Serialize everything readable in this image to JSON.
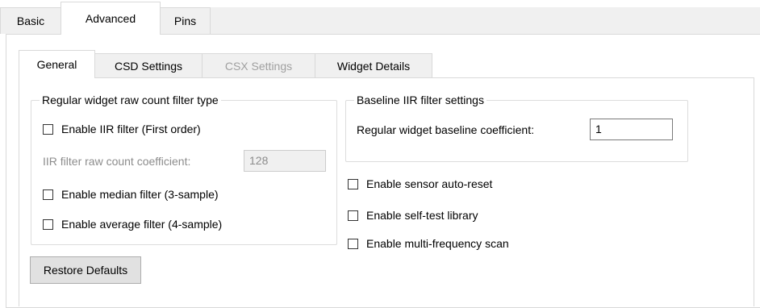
{
  "outer_tabs": [
    {
      "label": "Basic",
      "active": false
    },
    {
      "label": "Advanced",
      "active": true
    },
    {
      "label": "Pins",
      "active": false
    }
  ],
  "inner_tabs": [
    {
      "label": "General",
      "active": true,
      "enabled": true
    },
    {
      "label": "CSD Settings",
      "active": false,
      "enabled": true
    },
    {
      "label": "CSX Settings",
      "active": false,
      "enabled": false
    },
    {
      "label": "Widget Details",
      "active": false,
      "enabled": true
    }
  ],
  "raw_filter_group": {
    "title": "Regular widget raw count filter type",
    "enable_iir_label": "Enable IIR filter (First order)",
    "enable_iir_checked": false,
    "iir_coefficient_label": "IIR filter raw count coefficient:",
    "iir_coefficient_value": "128",
    "iir_coefficient_enabled": false,
    "enable_median_label": "Enable median filter (3-sample)",
    "enable_median_checked": false,
    "enable_average_label": "Enable average filter (4-sample)",
    "enable_average_checked": false
  },
  "baseline_group": {
    "title": "Baseline IIR filter settings",
    "coefficient_label": "Regular widget baseline coefficient:",
    "coefficient_value": "1"
  },
  "options": {
    "sensor_auto_reset_label": "Enable sensor auto-reset",
    "sensor_auto_reset_checked": false,
    "self_test_label": "Enable self-test library",
    "self_test_checked": false,
    "multi_freq_label": "Enable multi-frequency scan",
    "multi_freq_checked": false
  },
  "restore_defaults_label": "Restore Defaults",
  "colors": {
    "tab_inactive_bg": "#f0f0f0",
    "border": "#d9d9d9",
    "disabled_text": "#8c8c8c",
    "button_bg": "#e1e1e1"
  }
}
